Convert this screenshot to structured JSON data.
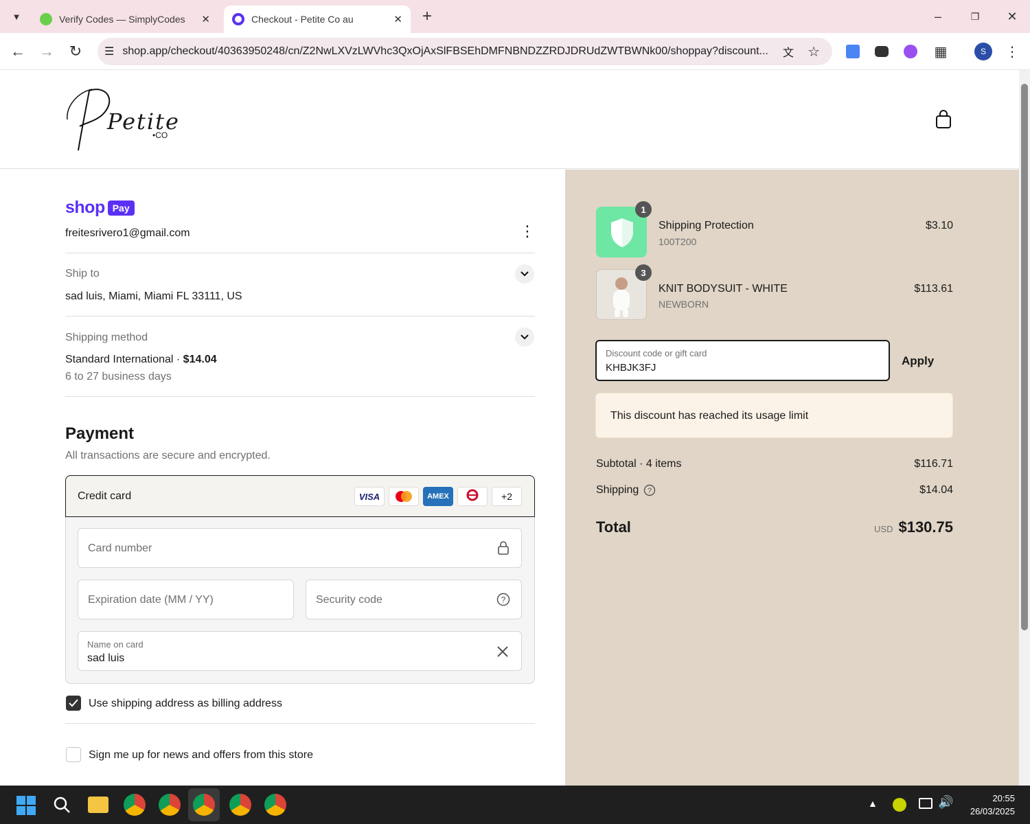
{
  "browser": {
    "tabs": [
      {
        "title": "Verify Codes — SimplyCodes",
        "active": false
      },
      {
        "title": "Checkout - Petite Co au",
        "active": true
      }
    ],
    "url": "shop.app/checkout/40363950248/cn/Z2NwLXVzLWVhc3QxOjAxSlFBSEhDMFNBNDZZRDJDRUdZWTBWNk00/shoppay?discount..."
  },
  "store": {
    "logo_text": "Petite",
    "logo_sub": "•CO"
  },
  "shoppay": {
    "brand": "shop",
    "badge": "Pay",
    "email": "freitesrivero1@gmail.com"
  },
  "ship_to": {
    "label": "Ship to",
    "value": "sad luis, Miami, Miami FL 33111, US"
  },
  "shipping_method": {
    "label": "Shipping method",
    "name": "Standard International",
    "separator": " · ",
    "price": "$14.04",
    "eta": "6 to 27 business days"
  },
  "payment": {
    "title": "Payment",
    "subtitle": "All transactions are secure and encrypted.",
    "method": "Credit card",
    "card_logos": [
      "VISA",
      "mastercard",
      "AMEX",
      "eftpos",
      "+2"
    ],
    "card_number_placeholder": "Card number",
    "expiration_placeholder": "Expiration date (MM / YY)",
    "security_placeholder": "Security code",
    "name_label": "Name on card",
    "name_value": "sad luis",
    "billing_checkbox": "Use shipping address as billing address",
    "billing_checked": true,
    "news_checkbox": "Sign me up for news and offers from this store",
    "news_checked": false
  },
  "summary": {
    "items": [
      {
        "name": "Shipping Protection",
        "variant": "100T200",
        "price": "$3.10",
        "qty": "1"
      },
      {
        "name": "KNIT BODYSUIT - WHITE",
        "variant": "NEWBORN",
        "price": "$113.61",
        "qty": "3"
      }
    ],
    "discount_label": "Discount code or gift card",
    "discount_value": "KHBJK3FJ",
    "apply": "Apply",
    "error": "This discount has reached its usage limit",
    "subtotal_label": "Subtotal · 4 items",
    "subtotal": "$116.71",
    "shipping_label": "Shipping",
    "shipping": "$14.04",
    "total_label": "Total",
    "currency": "USD",
    "total": "$130.75"
  },
  "taskbar": {
    "time": "20:55",
    "date": "26/03/2025"
  },
  "colors": {
    "shop_purple": "#5a31f4",
    "summary_bg": "#e0d5c6",
    "protection_green": "#6ee6a4",
    "error_bg": "#fbf3e7"
  }
}
